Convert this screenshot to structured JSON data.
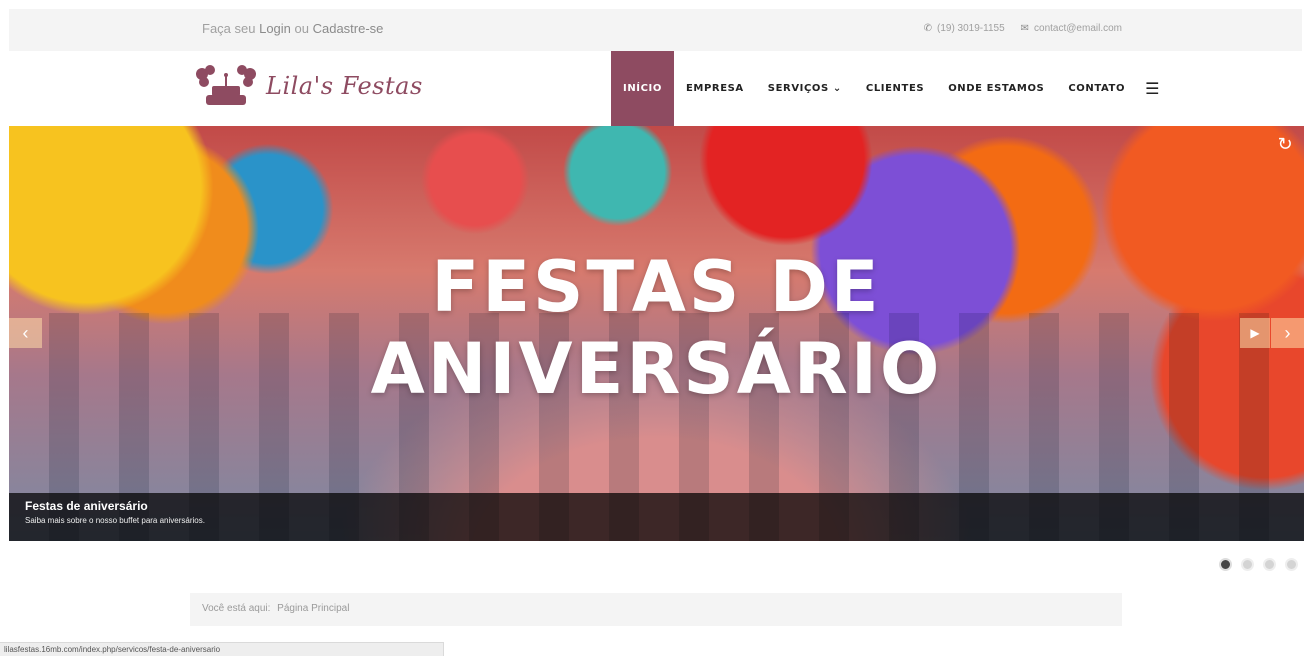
{
  "topbar": {
    "login_prefix": "Faça seu ",
    "login_link": "Login",
    "login_mid": " ou ",
    "register_link": "Cadastre-se",
    "phone_icon": "phone-icon",
    "phone": "(19) 3019-1155",
    "mail_icon": "envelope-icon",
    "email": "contact@email.com"
  },
  "header": {
    "logo_text": "Lila's Festas",
    "nav": [
      {
        "label": "INÍCIO",
        "active": true
      },
      {
        "label": "EMPRESA"
      },
      {
        "label": "SERVIÇOS ⌄"
      },
      {
        "label": "CLIENTES"
      },
      {
        "label": "ONDE ESTAMOS"
      },
      {
        "label": "CONTATO"
      }
    ],
    "menu_icon": "hamburger-icon",
    "accent_color": "#8e4b61"
  },
  "slider": {
    "title_line1": "FESTAS DE",
    "title_line2": "ANIVERSÁRIO",
    "caption_title": "Festas de aniversário",
    "caption_sub": "Saiba mais sobre o nosso buffet para aniversários.",
    "prev_icon": "chevron-left-icon",
    "next_icon": "chevron-right-icon",
    "play_icon": "play-icon",
    "loader_icon": "reload-icon",
    "slide_count": 4,
    "active_slide": 1
  },
  "breadcrumb": {
    "prefix": "Você está aqui:",
    "current": "Página Principal"
  },
  "status_bar": {
    "url": "lilasfestas.16mb.com/index.php/servicos/festa-de-aniversario"
  }
}
